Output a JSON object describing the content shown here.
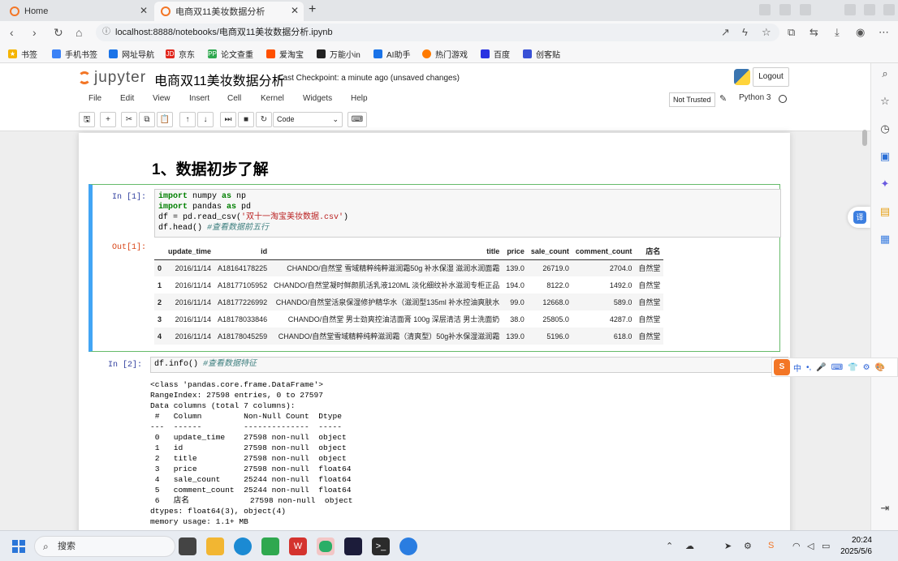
{
  "browser": {
    "tabs": [
      {
        "label": "Home"
      },
      {
        "label": "电商双11美妆数据分析"
      }
    ],
    "url": "localhost:8888/notebooks/电商双11美妆数据分析.ipynb",
    "bookmarks": [
      "书签",
      "手机书签",
      "网址导航",
      "京东",
      "论文查重",
      "爱淘宝",
      "万能小in",
      "AI助手",
      "热门游戏",
      "百度",
      "创客贴"
    ]
  },
  "jupyter": {
    "logo_text": "jupyter",
    "notebook_title": "电商双11美妆数据分析",
    "checkpoint": "Last Checkpoint: a minute ago (unsaved changes)",
    "logout": "Logout",
    "menus": [
      "File",
      "Edit",
      "View",
      "Insert",
      "Cell",
      "Kernel",
      "Widgets",
      "Help"
    ],
    "trust": "Not Trusted",
    "kernel": "Python 3",
    "cell_type": "Code"
  },
  "notebook": {
    "heading": "1、数据初步了解",
    "cell1": {
      "in_prompt": "In  [1]:",
      "out_prompt": "Out[1]:",
      "lines": [
        {
          "kw": "import",
          "rest": " numpy ",
          "kw2": "as",
          "rest2": " np"
        },
        {
          "kw": "import",
          "rest": " pandas ",
          "kw2": "as",
          "rest2": " pd"
        }
      ],
      "line3_a": "df = pd.read_csv(",
      "line3_str": "'双十一淘宝美妆数据.csv'",
      "line3_b": ")",
      "line4_a": "df.head() ",
      "line4_cm": "#查看数据前五行"
    },
    "table": {
      "columns": [
        "",
        "update_time",
        "id",
        "title",
        "price",
        "sale_count",
        "comment_count",
        "店名"
      ],
      "rows": [
        [
          "0",
          "2016/11/14",
          "A18164178225",
          "CHANDO/自然堂 雪域精粹纯粹滋润霜50g 补水保湿 滋润水润面霜",
          "139.0",
          "26719.0",
          "2704.0",
          "自然堂"
        ],
        [
          "1",
          "2016/11/14",
          "A18177105952",
          "CHANDO/自然堂凝时鲜颜肌活乳液120ML 淡化细纹补水滋润专柜正品",
          "194.0",
          "8122.0",
          "1492.0",
          "自然堂"
        ],
        [
          "2",
          "2016/11/14",
          "A18177226992",
          "CHANDO/自然堂活泉保湿修护精华水（滋润型135ml 补水控油爽肤水",
          "99.0",
          "12668.0",
          "589.0",
          "自然堂"
        ],
        [
          "3",
          "2016/11/14",
          "A18178033846",
          "CHANDO/自然堂 男士劲爽控油洁面膏 100g 深层清洁 男士洗面奶",
          "38.0",
          "25805.0",
          "4287.0",
          "自然堂"
        ],
        [
          "4",
          "2016/11/14",
          "A18178045259",
          "CHANDO/自然堂雪域精粹纯粹滋润霜（清爽型）50g补水保湿滋润霜",
          "139.0",
          "5196.0",
          "618.0",
          "自然堂"
        ]
      ]
    },
    "cell2": {
      "in_prompt": "In  [2]:",
      "code_a": "df.info() ",
      "code_cm": "#查看数据特征",
      "output": "<class 'pandas.core.frame.DataFrame'>\nRangeIndex: 27598 entries, 0 to 27597\nData columns (total 7 columns):\n #   Column         Non-Null Count  Dtype  \n---  ------         --------------  -----  \n 0   update_time    27598 non-null  object \n 1   id             27598 non-null  object \n 2   title          27598 non-null  object \n 3   price          27598 non-null  float64\n 4   sale_count     25244 non-null  float64\n 5   comment_count  25244 non-null  float64\n 6   店名             27598 non-null  object \ndtypes: float64(3), object(4)\nmemory usage: 1.1+ MB"
    }
  },
  "ime": {
    "items": [
      "中",
      "•,",
      "🎤",
      "⌨",
      "👕",
      "⚙",
      "🎨"
    ]
  },
  "taskbar": {
    "search_placeholder": "搜索",
    "time": "20:24",
    "date": "2025/5/6"
  },
  "colors": {
    "jupyter_orange": "#f37626",
    "selected_cell_border": "#66bb6a",
    "selected_cell_left": "#42a5f5"
  }
}
